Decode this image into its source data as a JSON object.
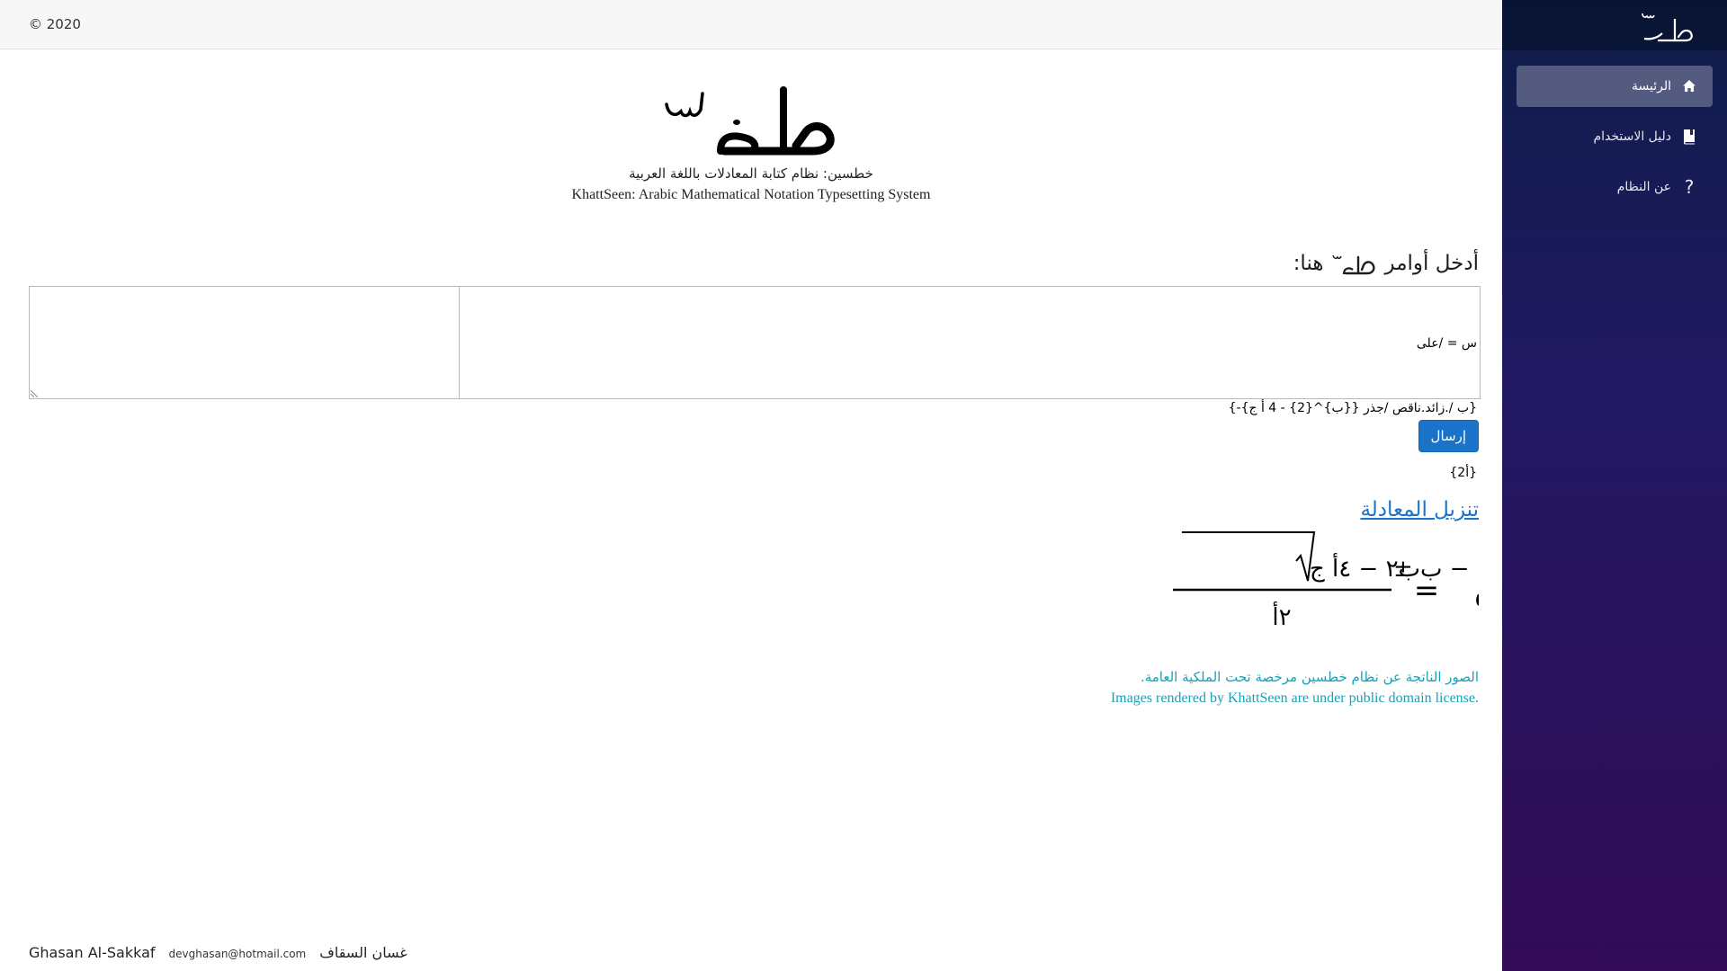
{
  "brand": {
    "logo_text": "خط س"
  },
  "topbar": {
    "copyright": "© 2020"
  },
  "nav": {
    "items": [
      {
        "label": "الرئيسة",
        "icon": "home-icon",
        "active": true
      },
      {
        "label": "دليل الاستخدام",
        "icon": "book-icon",
        "active": false
      },
      {
        "label": "عن النظام",
        "icon": "question-icon",
        "active": false
      }
    ]
  },
  "hero": {
    "logo_text": "خط س",
    "subtitle_ar": "خطسين: نظام كتابة المعادلات باللغة العربية",
    "subtitle_en": "KhattSeen: Arabic Mathematical Notation Typesetting System"
  },
  "editor": {
    "heading_prefix": "أدخل أوامر",
    "heading_logo": "خط س",
    "heading_suffix": "هنا:",
    "lines": [
      "س = /على",
      "{-ب /.زائد.ناقص /جذر {{ب}^{2} - 4 أ ج}}",
      "{2أ}"
    ]
  },
  "submit_label": "إرسال",
  "download_label": "تنزيل المعادلة",
  "equation": {
    "lhs": "س",
    "equals": "=",
    "numerator_prefix": "− ب ±",
    "radicand": "ب٢ − ٤أ ج",
    "denominator": "٢أ"
  },
  "license": {
    "ar": "الصور الناتجة عن نظام خطسين مرخصة تحت الملكية العامة.",
    "en": "Images rendered by KhattSeen are under public domain license."
  },
  "footer": {
    "name_en": "Ghasan Al-Sakkaf",
    "email": "devghasan@hotmail.com",
    "name_ar": "غسان السقاف"
  },
  "colors": {
    "accent": "#1a73c9",
    "license_text": "#17a2b8",
    "sidebar_top": "#0d1d48",
    "sidebar_bottom": "#320c56"
  }
}
